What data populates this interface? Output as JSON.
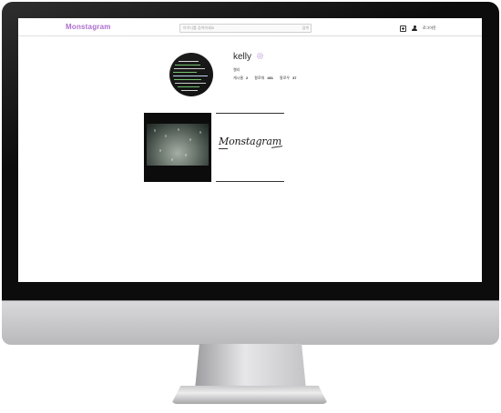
{
  "header": {
    "logo": "Monstagram",
    "search_placeholder": "아이디를 검색하세요",
    "search_button": "검색",
    "logout": "로그아웃",
    "icons": [
      "add-post-icon",
      "profile-icon"
    ]
  },
  "profile": {
    "username": "kelly",
    "name": "켈리",
    "stats": {
      "posts_label": "게시물",
      "posts": "2",
      "followers_label": "팔로워",
      "followers": "481",
      "following_label": "팔로우",
      "following": "37"
    },
    "settings_icon": "gear-icon"
  },
  "posts": [
    {
      "type": "photo",
      "description_icon": "rainy-window-photo"
    },
    {
      "type": "logo",
      "text": "Monstagram"
    }
  ],
  "colors": {
    "accent": "#a35fc9",
    "bezel": "#0c0c0c",
    "stand": "#c4c4c6"
  }
}
